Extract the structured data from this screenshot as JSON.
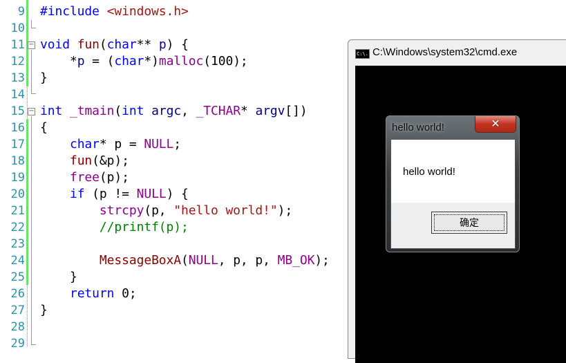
{
  "editor": {
    "first_line": 9,
    "lines": [
      [
        [
          "#include ",
          "k"
        ],
        [
          "<windows.h>",
          "s"
        ]
      ],
      [],
      [
        [
          "void",
          "k"
        ],
        [
          " "
        ],
        [
          "fun",
          "f"
        ],
        [
          "("
        ],
        [
          "char",
          "k"
        ],
        [
          "** "
        ],
        [
          "p",
          "v"
        ],
        [
          ") {"
        ]
      ],
      [
        [
          "    *"
        ],
        [
          "p",
          "v"
        ],
        [
          " = ("
        ],
        [
          "char",
          "k"
        ],
        [
          "*)"
        ],
        [
          "malloc",
          "m"
        ],
        [
          "(100);"
        ]
      ],
      [
        [
          "}"
        ]
      ],
      [],
      [
        [
          "int",
          "k"
        ],
        [
          " "
        ],
        [
          "_tmain",
          "m"
        ],
        [
          "("
        ],
        [
          "int",
          "k"
        ],
        [
          " "
        ],
        [
          "argc",
          "v"
        ],
        [
          ", "
        ],
        [
          "_TCHAR",
          "m"
        ],
        [
          "* "
        ],
        [
          "argv",
          "v"
        ],
        [
          "[])"
        ]
      ],
      [
        [
          "{"
        ]
      ],
      [
        [
          "    "
        ],
        [
          "char",
          "k"
        ],
        [
          "* p = "
        ],
        [
          "NULL",
          "m"
        ],
        [
          ";"
        ]
      ],
      [
        [
          "    "
        ],
        [
          "fun",
          "f"
        ],
        [
          "(&p);"
        ]
      ],
      [
        [
          "    "
        ],
        [
          "free",
          "m"
        ],
        [
          "(p);"
        ]
      ],
      [
        [
          "    "
        ],
        [
          "if",
          "k"
        ],
        [
          " (p != "
        ],
        [
          "NULL",
          "m"
        ],
        [
          ") {"
        ]
      ],
      [
        [
          "        "
        ],
        [
          "strcpy",
          "m"
        ],
        [
          "(p, "
        ],
        [
          "\"hello world!\"",
          "s"
        ],
        [
          ");"
        ]
      ],
      [
        [
          "        "
        ],
        [
          "//printf(p);",
          "c"
        ]
      ],
      [],
      [
        [
          "        "
        ],
        [
          "MessageBoxA",
          "f"
        ],
        [
          "("
        ],
        [
          "NULL",
          "m"
        ],
        [
          ", p, p, "
        ],
        [
          "MB_OK",
          "m"
        ],
        [
          ");"
        ]
      ],
      [
        [
          "    }"
        ]
      ],
      [
        [
          "    "
        ],
        [
          "return",
          "k"
        ],
        [
          " 0;"
        ]
      ],
      [
        [
          "}"
        ]
      ],
      [],
      []
    ]
  },
  "cmd": {
    "title": "C:\\Windows\\system32\\cmd.exe",
    "icon": "C:\\."
  },
  "dialog": {
    "title": "hello world!",
    "message": "hello world!",
    "ok_label": "确定",
    "close_glyph": "✕"
  }
}
